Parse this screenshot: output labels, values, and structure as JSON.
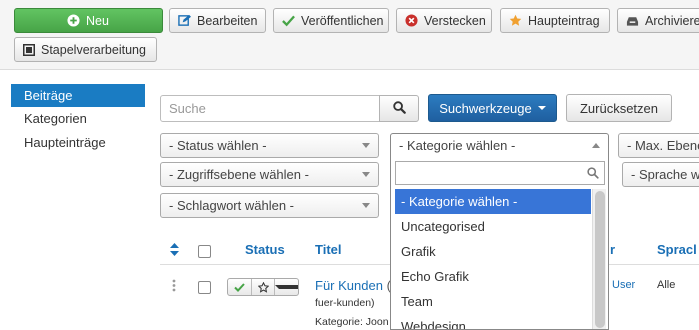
{
  "toolbar": {
    "new": "Neu",
    "edit": "Bearbeiten",
    "publish": "Veröffentlichen",
    "unpublish": "Verstecken",
    "featured": "Haupteintrag",
    "archive": "Archivieren",
    "batch": "Stapelverarbeitung"
  },
  "sidebar": {
    "items": [
      {
        "label": "Beiträge"
      },
      {
        "label": "Kategorien"
      },
      {
        "label": "Haupteinträge"
      }
    ]
  },
  "search": {
    "placeholder": "Suche",
    "tools_label": "Suchwerkzeuge",
    "reset_label": "Zurücksetzen"
  },
  "filters": {
    "status": "- Status wählen -",
    "category": "- Kategorie wählen -",
    "max_levels": "- Max. Ebenen -",
    "access": "- Zugriffsebene wählen -",
    "language": "- Sprache wählen -",
    "tag": "- Schlagwort wählen -"
  },
  "category_dropdown": {
    "search_value": "",
    "options": [
      {
        "label": "- Kategorie wählen -",
        "selected": true
      },
      {
        "label": "Uncategorised",
        "selected": false
      },
      {
        "label": "Grafik",
        "selected": false
      },
      {
        "label": "Echo Grafik",
        "selected": false
      },
      {
        "label": "Team",
        "selected": false
      },
      {
        "label": "Webdesign",
        "selected": false
      }
    ]
  },
  "table": {
    "headers": {
      "status": "Status",
      "title": "Titel",
      "author_fragment": "r",
      "language_fragment": "Spracl"
    },
    "rows": [
      {
        "title": "Für Kunden",
        "title_suffix": "(",
        "alias": "fuer-kunden)",
        "category": "Kategorie: Joon",
        "author": "User",
        "language": "Alle"
      }
    ]
  },
  "colors": {
    "accent": "#1a7cc3",
    "primary_button": "#2c7cc0",
    "new_button": "#5cb85c",
    "selected_option": "#3875d7"
  }
}
